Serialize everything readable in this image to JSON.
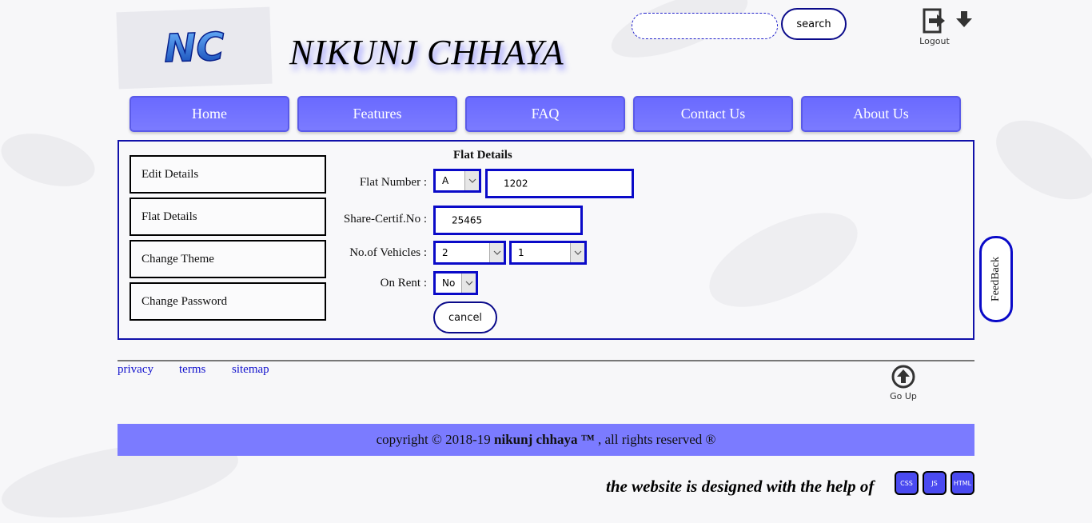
{
  "header": {
    "logo_text": "NC",
    "site_title": "NIKUNJ CHHAYA",
    "search_placeholder": "",
    "search_button": "search",
    "logout_label": "Logout"
  },
  "nav": {
    "items": [
      {
        "label": "Home"
      },
      {
        "label": "Features"
      },
      {
        "label": "FAQ"
      },
      {
        "label": "Contact Us"
      },
      {
        "label": "About Us"
      }
    ]
  },
  "sidebar": {
    "items": [
      {
        "label": "Edit Details"
      },
      {
        "label": "Flat Details"
      },
      {
        "label": "Change Theme"
      },
      {
        "label": "Change Password"
      }
    ]
  },
  "form": {
    "heading": "Flat Details",
    "flat_number_label": "Flat Number :",
    "wing_value": "A",
    "flat_number_value": "1202",
    "share_cert_label": "Share-Certif.No :",
    "share_cert_value": "25465",
    "vehicles_label": "No.of Vehicles :",
    "vehicles_value_1": "2",
    "vehicles_value_2": "1",
    "on_rent_label": "On Rent :",
    "on_rent_value": "No",
    "cancel_button": "cancel"
  },
  "feedback_label": "FeedBack",
  "footer": {
    "links": [
      {
        "label": "privacy"
      },
      {
        "label": "terms"
      },
      {
        "label": "sitemap"
      }
    ],
    "goup_label": "Go Up",
    "copyright_prefix": "copyright © 2018-19 ",
    "copyright_brand": "nikunj chhaya ™",
    "copyright_suffix": " , all rights reserved ®",
    "designed_text": "the website is designed with the help of",
    "tech_badges": [
      "CSS",
      "JS",
      "HTML"
    ]
  },
  "colors": {
    "nav_bg": "#6a6aff",
    "border_blue": "#0a0ac8",
    "footer_bar": "#7b7bff"
  },
  "icons": {
    "logout": "logout-icon",
    "download": "download-icon",
    "goup": "arrow-up-circle-icon",
    "dropdown": "chevron-down-icon"
  }
}
